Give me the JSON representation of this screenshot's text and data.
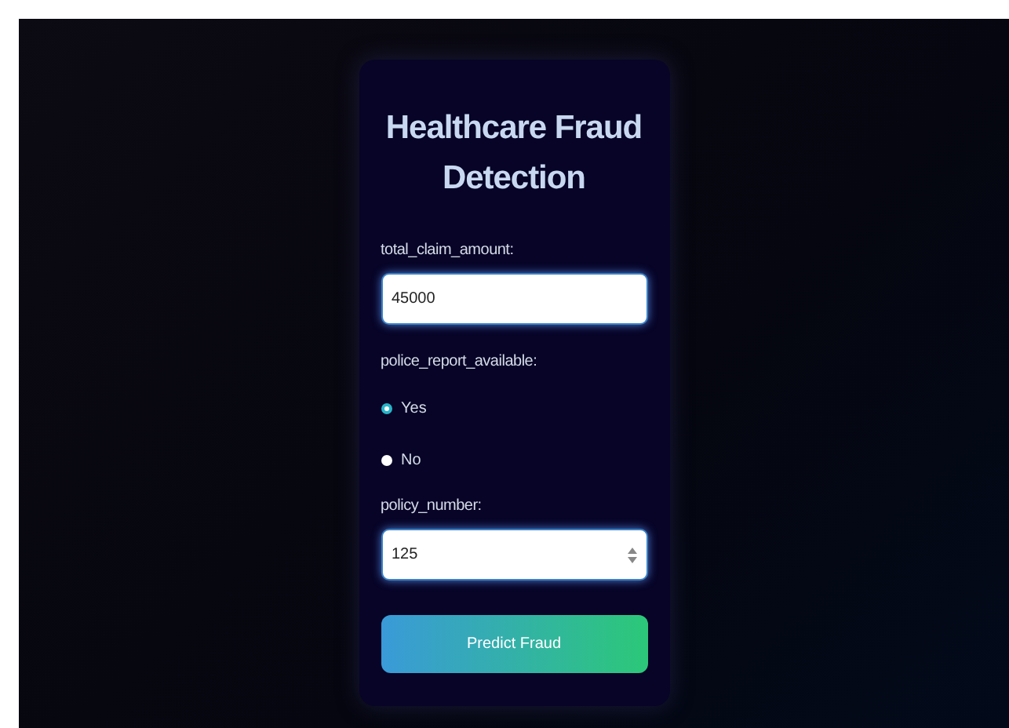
{
  "title": "Healthcare Fraud Detection",
  "fields": [
    {
      "kind": "text",
      "label": "total_claim_amount:",
      "value": "45000"
    },
    {
      "kind": "radio",
      "label": "police_report_available:",
      "options": [
        {
          "label": "Yes",
          "selected": true
        },
        {
          "label": "No",
          "selected": false
        }
      ]
    },
    {
      "kind": "number",
      "label": "policy_number:",
      "value": "125"
    }
  ],
  "button": "Predict Fraud"
}
